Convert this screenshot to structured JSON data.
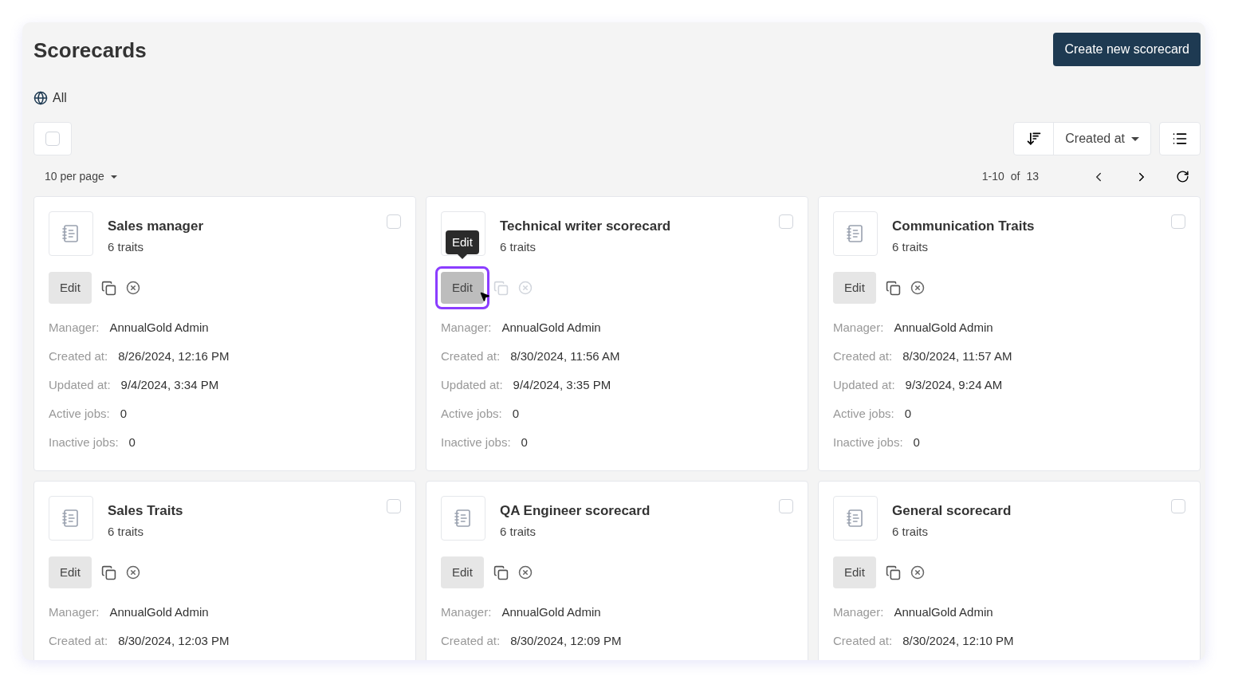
{
  "page": {
    "title": "Scorecards",
    "create_button": "Create new scorecard"
  },
  "filter": {
    "label": "All"
  },
  "select_all": {
    "checked": false
  },
  "sort": {
    "label": "Created at"
  },
  "per_page": "10 per page",
  "pagination": {
    "range": "1-10",
    "of": "of",
    "total": "13"
  },
  "tooltip": "Edit",
  "cards": [
    {
      "title": "Sales manager",
      "traits": "6 traits",
      "checked": false,
      "hovered": false,
      "edit": "Edit",
      "fields": [
        {
          "label": "Manager:",
          "value": "AnnualGold Admin"
        },
        {
          "label": "Created at:",
          "value": "8/26/2024, 12:16 PM"
        },
        {
          "label": "Updated at:",
          "value": "9/4/2024, 3:34 PM"
        },
        {
          "label": "Active jobs:",
          "value": "0"
        },
        {
          "label": "Inactive jobs:",
          "value": "0"
        }
      ]
    },
    {
      "title": "Technical writer scorecard",
      "traits": "6 traits",
      "checked": false,
      "hovered": true,
      "edit": "Edit",
      "fields": [
        {
          "label": "Manager:",
          "value": "AnnualGold Admin"
        },
        {
          "label": "Created at:",
          "value": "8/30/2024, 11:56 AM"
        },
        {
          "label": "Updated at:",
          "value": "9/4/2024, 3:35 PM"
        },
        {
          "label": "Active jobs:",
          "value": "0"
        },
        {
          "label": "Inactive jobs:",
          "value": "0"
        }
      ]
    },
    {
      "title": "Communication Traits",
      "traits": "6 traits",
      "checked": false,
      "hovered": false,
      "edit": "Edit",
      "fields": [
        {
          "label": "Manager:",
          "value": "AnnualGold Admin"
        },
        {
          "label": "Created at:",
          "value": "8/30/2024, 11:57 AM"
        },
        {
          "label": "Updated at:",
          "value": "9/3/2024, 9:24 AM"
        },
        {
          "label": "Active jobs:",
          "value": "0"
        },
        {
          "label": "Inactive jobs:",
          "value": "0"
        }
      ]
    },
    {
      "title": "Sales Traits",
      "traits": "6 traits",
      "checked": false,
      "hovered": false,
      "edit": "Edit",
      "fields": [
        {
          "label": "Manager:",
          "value": "AnnualGold Admin"
        },
        {
          "label": "Created at:",
          "value": "8/30/2024, 12:03 PM"
        }
      ]
    },
    {
      "title": "QA Engineer scorecard",
      "traits": "6 traits",
      "checked": false,
      "hovered": false,
      "edit": "Edit",
      "fields": [
        {
          "label": "Manager:",
          "value": "AnnualGold Admin"
        },
        {
          "label": "Created at:",
          "value": "8/30/2024, 12:09 PM"
        }
      ]
    },
    {
      "title": "General scorecard",
      "traits": "6 traits",
      "checked": false,
      "hovered": false,
      "edit": "Edit",
      "fields": [
        {
          "label": "Manager:",
          "value": "AnnualGold Admin"
        },
        {
          "label": "Created at:",
          "value": "8/30/2024, 12:10 PM"
        }
      ]
    }
  ]
}
